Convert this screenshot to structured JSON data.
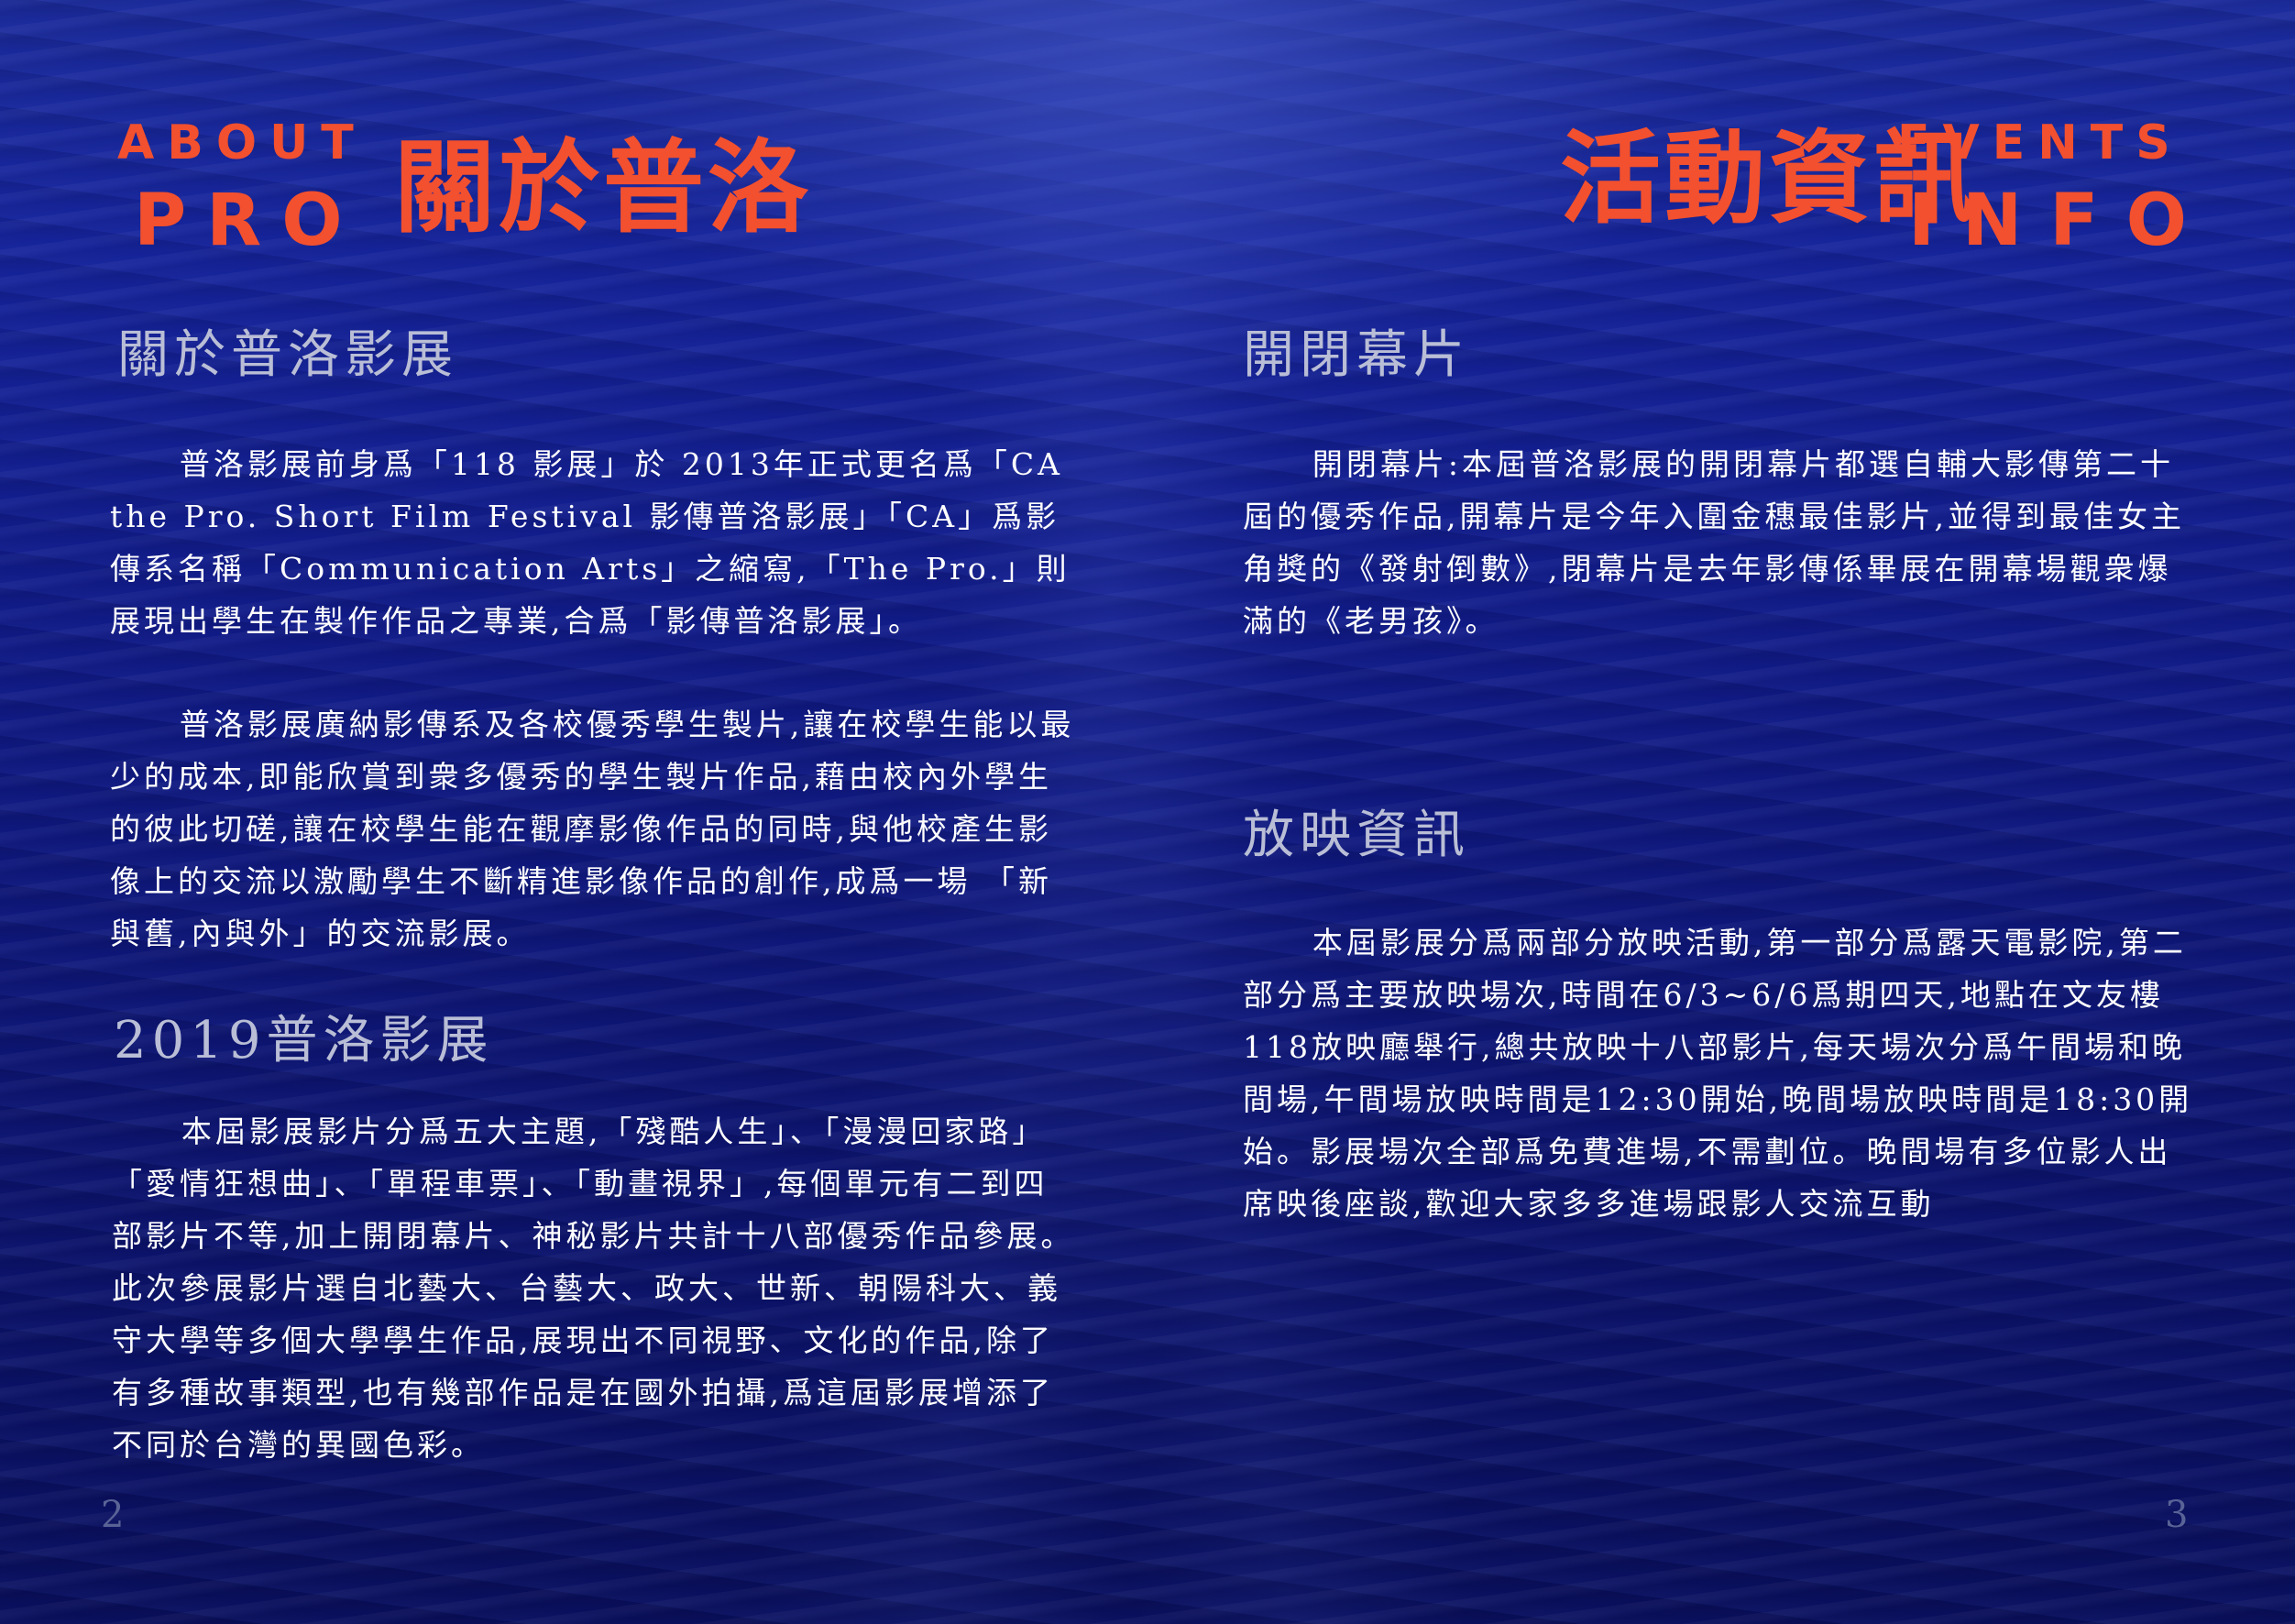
{
  "left_page": {
    "title_en_line1": "ABOUT",
    "title_en_line2": "PRO",
    "title_zh": "關於普洛",
    "section1_heading": "關於普洛影展",
    "section1_para1": "普洛影展前身爲「118 影展」於 2013年正式更名爲「CA the Pro. Short Film Festival 影傳普洛影展」「CA」爲影傳系名稱「Communication Arts」之縮寫,「The Pro.」則展現出學生在製作作品之專業,合爲「影傳普洛影展」。",
    "section1_para2": "普洛影展廣納影傳系及各校優秀學生製片,讓在校學生能以最少的成本,即能欣賞到衆多優秀的學生製片作品,藉由校內外學生的彼此切磋,讓在校學生能在觀摩影像作品的同時,與他校產生影像上的交流以激勵學生不斷精進影像作品的創作,成爲一場 「新與舊,內與外」的交流影展。",
    "section2_heading": "2019普洛影展",
    "section2_para": "本屆影展影片分爲五大主題,「殘酷人生」、「漫漫回家路」「愛情狂想曲」、「單程車票」、「動畫視界」,每個單元有二到四部影片不等,加上開閉幕片、神秘影片共計十八部優秀作品參展。此次參展影片選自北藝大、台藝大、政大、世新、朝陽科大、義守大學等多個大學學生作品,展現出不同視野、文化的作品,除了有多種故事類型,也有幾部作品是在國外拍攝,爲這屆影展增添了不同於台灣的異國色彩。",
    "page_number": "2"
  },
  "right_page": {
    "title_zh": "活動資訊",
    "title_en_line1": "EVENTS",
    "title_en_line2": "INFO",
    "section1_heading": "開閉幕片",
    "section1_para": "開閉幕片:本屆普洛影展的開閉幕片都選自輔大影傳第二十屆的優秀作品,開幕片是今年入圍金穗最佳影片,並得到最佳女主角獎的《發射倒數》,閉幕片是去年影傳係畢展在開幕場觀衆爆滿的《老男孩》。",
    "section2_heading": "放映資訊",
    "section2_para": "本屆影展分爲兩部分放映活動,第一部分爲露天電影院,第二部分爲主要放映場次,時間在6/3~6/6爲期四天,地點在文友樓118放映廳舉行,總共放映十八部影片,每天場次分爲午間場和晚間場,午間場放映時間是12:30開始,晚間場放映時間是18:30開始。影展場次全部爲免費進場,不需劃位。晚間場有多位影人出席映後座談,歡迎大家多多進場跟影人交流互動",
    "page_number": "3"
  },
  "colors": {
    "title_orange": "#f2502e",
    "heading_gray": "#b9bed6",
    "body_text": "#ffffff",
    "page_number": "#5a6396",
    "background_deep_blue": "#0b1260"
  }
}
